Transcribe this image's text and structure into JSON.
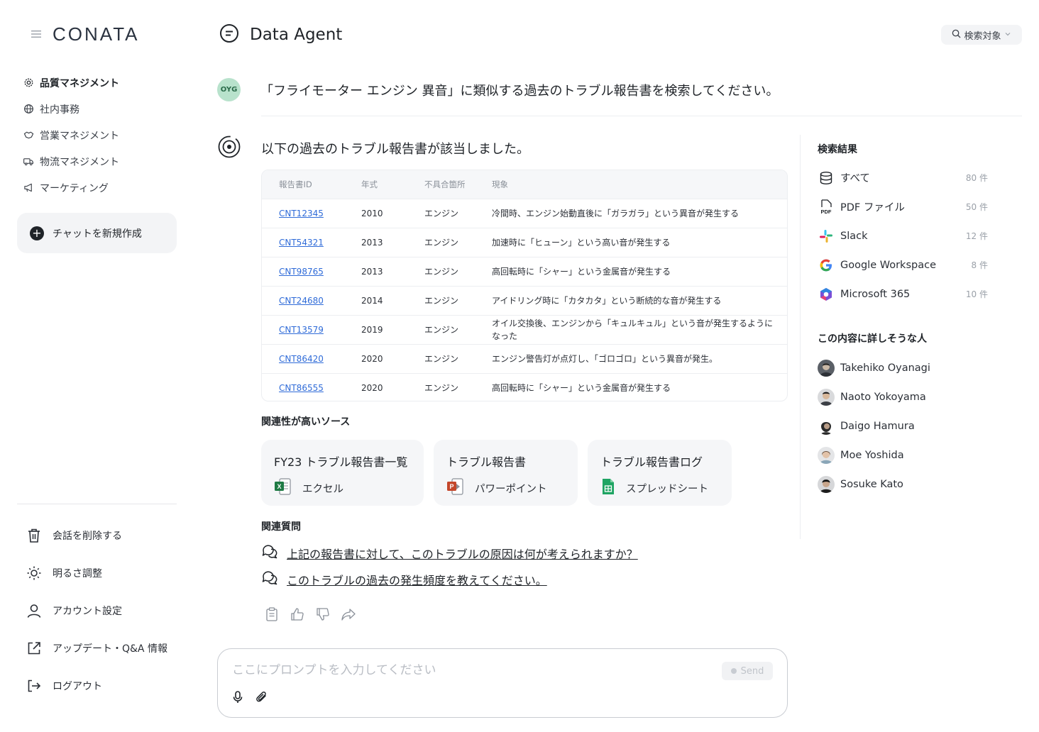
{
  "sidebar": {
    "logo": "CONATA",
    "nav": [
      {
        "label": "品質マネジメント",
        "icon": "gear-icon",
        "active": true
      },
      {
        "label": "社内事務",
        "icon": "globe-icon"
      },
      {
        "label": "営業マネジメント",
        "icon": "handshake-icon"
      },
      {
        "label": "物流マネジメント",
        "icon": "truck-icon"
      },
      {
        "label": "マーケティング",
        "icon": "megaphone-icon"
      }
    ],
    "new_chat": "チャットを新規作成",
    "bottom": [
      {
        "label": "会話を削除する",
        "icon": "trash-icon"
      },
      {
        "label": "明るさ調整",
        "icon": "sun-icon"
      },
      {
        "label": "アカウント設定",
        "icon": "user-icon"
      },
      {
        "label": "アップデート・Q&A 情報",
        "icon": "external-link-icon"
      },
      {
        "label": "ログアウト",
        "icon": "logout-icon"
      }
    ]
  },
  "header": {
    "title": "Data Agent",
    "search_scope": "検索対象"
  },
  "conversation": {
    "user_initials": "OYG",
    "user_message": "「フライモーター エンジン 異音」に類似する過去のトラブル報告書を検索してください。",
    "answer": "以下の過去のトラブル報告書が該当しました。",
    "table": {
      "headers": [
        "報告書ID",
        "年式",
        "不具合箇所",
        "現象"
      ],
      "rows": [
        [
          "CNT12345",
          "2010",
          "エンジン",
          "冷間時、エンジン始動直後に「ガラガラ」という異音が発生する"
        ],
        [
          "CNT54321",
          "2013",
          "エンジン",
          "加速時に「ヒューン」という高い音が発生する"
        ],
        [
          "CNT98765",
          "2013",
          "エンジン",
          "高回転時に「シャー」という金属音が発生する"
        ],
        [
          "CNT24680",
          "2014",
          "エンジン",
          "アイドリング時に「カタカタ」という断続的な音が発生する"
        ],
        [
          "CNT13579",
          "2019",
          "エンジン",
          "オイル交換後、エンジンから「キュルキュル」という音が発生するようになった"
        ],
        [
          "CNT86420",
          "2020",
          "エンジン",
          "エンジン警告灯が点灯し、「ゴロゴロ」という異音が発生。"
        ],
        [
          "CNT86555",
          "2020",
          "エンジン",
          "高回転時に「シャー」という金属音が発生する"
        ]
      ]
    },
    "sources_label": "関連性が高いソース",
    "sources": [
      {
        "title": "FY23 トラブル報告書一覧",
        "type": "エクセル",
        "icon": "excel-icon"
      },
      {
        "title": "トラブル報告書",
        "type": "パワーポイント",
        "icon": "powerpoint-icon"
      },
      {
        "title": "トラブル報告書ログ",
        "type": "スプレッドシート",
        "icon": "sheets-icon"
      }
    ],
    "related_label": "関連質問",
    "related_questions": [
      "上記の報告書に対して、このトラブルの原因は何が考えられますか？",
      "このトラブルの過去の発生頻度を教えてください。"
    ]
  },
  "prompt": {
    "placeholder": "ここにプロンプトを入力してください",
    "send": "Send"
  },
  "right_panel": {
    "results_label": "検索結果",
    "results": [
      {
        "label": "すべて",
        "count": "80 件",
        "icon": "database-icon"
      },
      {
        "label": "PDF ファイル",
        "count": "50 件",
        "icon": "pdf-icon"
      },
      {
        "label": "Slack",
        "count": "12 件",
        "icon": "slack-icon"
      },
      {
        "label": "Google Workspace",
        "count": "8 件",
        "icon": "google-icon"
      },
      {
        "label": "Microsoft 365",
        "count": "10 件",
        "icon": "microsoft365-icon"
      }
    ],
    "people_label": "この内容に詳しそうな人",
    "people": [
      "Takehiko Oyanagi",
      "Naoto Yokoyama",
      "Daigo Hamura",
      "Moe Yoshida",
      "Sosuke Kato"
    ]
  }
}
